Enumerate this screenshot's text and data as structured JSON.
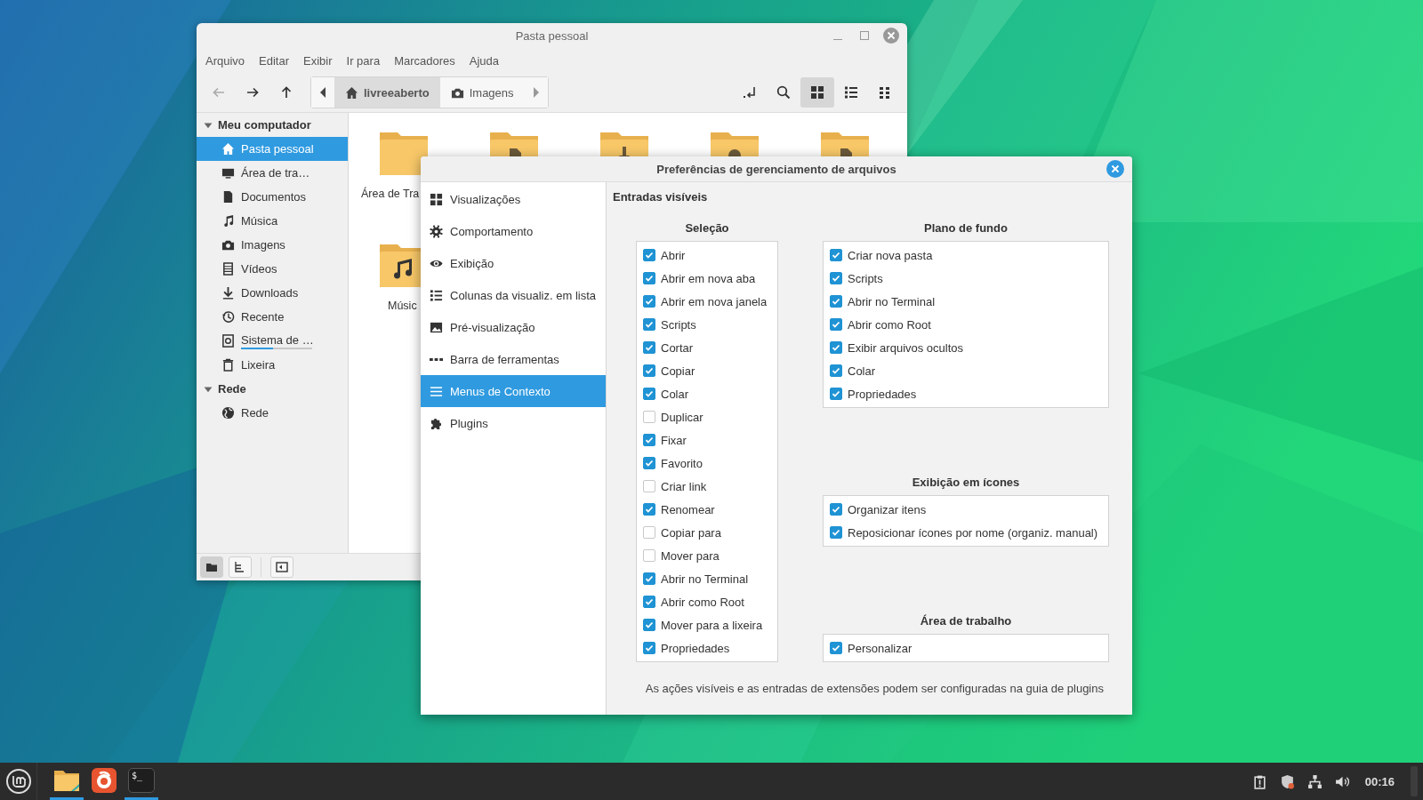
{
  "file_manager": {
    "title": "Pasta pessoal",
    "menu": [
      "Arquivo",
      "Editar",
      "Exibir",
      "Ir para",
      "Marcadores",
      "Ajuda"
    ],
    "nav_buttons": [
      {
        "disabled": true
      },
      {
        "disabled": false
      },
      {
        "disabled": false
      }
    ],
    "breadcrumbs": [
      {
        "label": "livreeaberto",
        "selected": true
      },
      {
        "label": "Imagens",
        "selected": false
      }
    ],
    "views": [
      {
        "selected": true
      },
      {
        "selected": false
      },
      {
        "selected": false
      }
    ],
    "sidebar": [
      {
        "label": "Meu computador",
        "expanded": true,
        "items": [
          {
            "label": "Pasta pessoal",
            "selected": true
          },
          {
            "label": "Área de tra…",
            "selected": false
          },
          {
            "label": "Documentos",
            "selected": false
          },
          {
            "label": "Música",
            "selected": false
          },
          {
            "label": "Imagens",
            "selected": false
          },
          {
            "label": "Vídeos",
            "selected": false
          },
          {
            "label": "Downloads",
            "selected": false
          },
          {
            "label": "Recente",
            "selected": false
          },
          {
            "label": "Sistema de …",
            "selected": false,
            "level": 0.45
          },
          {
            "label": "Lixeira",
            "selected": false
          }
        ]
      },
      {
        "label": "Rede",
        "expanded": true,
        "items": [
          {
            "label": "Rede",
            "selected": false
          }
        ]
      }
    ],
    "files": [
      {
        "label": "Área de Tra"
      },
      {
        "label": "Músic"
      }
    ],
    "bottom_buttons": [
      {
        "selected": true
      },
      {
        "selected": false
      },
      {
        "selected": false
      }
    ]
  },
  "dialog": {
    "title": "Preferências de gerenciamento de arquivos",
    "nav": [
      {
        "label": "Visualizações",
        "selected": false
      },
      {
        "label": "Comportamento",
        "selected": false
      },
      {
        "label": "Exibição",
        "selected": false
      },
      {
        "label": "Colunas da visualiz. em lista",
        "selected": false
      },
      {
        "label": "Pré-visualização",
        "selected": false
      },
      {
        "label": "Barra de ferramentas",
        "selected": false
      },
      {
        "label": "Menus de Contexto",
        "selected": true
      },
      {
        "label": "Plugins",
        "selected": false
      }
    ],
    "heading": "Entradas visíveis",
    "groups": [
      {
        "title": "Seleção",
        "items": [
          {
            "label": "Abrir",
            "checked": true
          },
          {
            "label": "Abrir em nova aba",
            "checked": true
          },
          {
            "label": "Abrir em nova janela",
            "checked": true
          },
          {
            "label": "Scripts",
            "checked": true
          },
          {
            "label": "Cortar",
            "checked": true
          },
          {
            "label": "Copiar",
            "checked": true
          },
          {
            "label": "Colar",
            "checked": true
          },
          {
            "label": "Duplicar",
            "checked": false
          },
          {
            "label": "Fixar",
            "checked": true
          },
          {
            "label": "Favorito",
            "checked": true
          },
          {
            "label": "Criar link",
            "checked": false
          },
          {
            "label": "Renomear",
            "checked": true
          },
          {
            "label": "Copiar para",
            "checked": false
          },
          {
            "label": "Mover para",
            "checked": false
          },
          {
            "label": "Abrir no Terminal",
            "checked": true
          },
          {
            "label": "Abrir como Root",
            "checked": true
          },
          {
            "label": "Mover para a lixeira",
            "checked": true
          },
          {
            "label": "Propriedades",
            "checked": true
          }
        ]
      },
      {
        "title": "Plano de fundo",
        "items": [
          {
            "label": "Criar nova pasta",
            "checked": true
          },
          {
            "label": "Scripts",
            "checked": true
          },
          {
            "label": "Abrir no Terminal",
            "checked": true
          },
          {
            "label": "Abrir como Root",
            "checked": true
          },
          {
            "label": "Exibir arquivos ocultos",
            "checked": true
          },
          {
            "label": "Colar",
            "checked": true
          },
          {
            "label": "Propriedades",
            "checked": true
          }
        ]
      },
      {
        "title": "Exibição em ícones",
        "items": [
          {
            "label": "Organizar itens",
            "checked": true
          },
          {
            "label": "Reposicionar ícones por nome (organiz. manual)",
            "checked": true
          }
        ]
      },
      {
        "title": "Área de trabalho",
        "items": [
          {
            "label": "Personalizar",
            "checked": true
          }
        ]
      }
    ],
    "footer": "As ações visíveis e as entradas de extensões podem ser configuradas na guia de plugins"
  },
  "taskbar": {
    "apps": [
      {
        "kind": "files",
        "running": true
      },
      {
        "kind": "browser",
        "running": false
      },
      {
        "kind": "terminal",
        "glyph": "$_",
        "running": true
      }
    ],
    "clock": "00:16"
  }
}
